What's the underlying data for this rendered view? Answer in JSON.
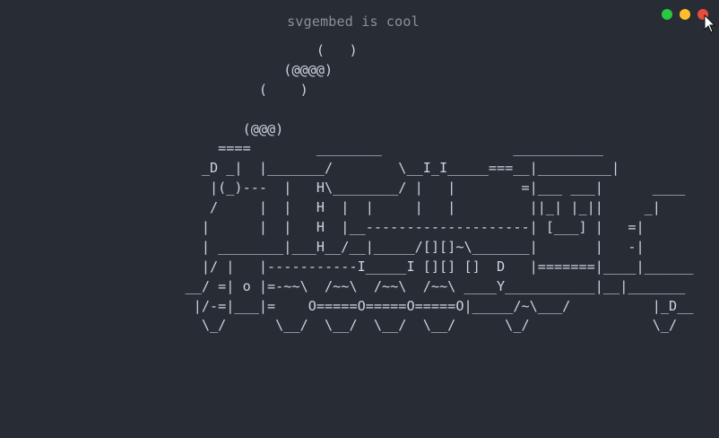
{
  "window": {
    "title": "svgembed is cool",
    "controls": {
      "minimize_color": "#28c840",
      "maximize_color": "#ffbd2e",
      "close_color": "#e74c3c"
    }
  },
  "ascii": {
    "lines": [
      "                    (   )",
      "                (@@@@)",
      "             (    )",
      "",
      "           (@@@)",
      "        ====        ________                ___________",
      "      _D _|  |_______/        \\__I_I_____===__|_________|",
      "       |(_)---  |   H\\________/ |   |        =|___ ___|      ____",
      "       /     |  |   H  |  |     |   |         ||_| |_||     _|",
      "      |      |  |   H  |__--------------------| [___] |   =|",
      "      | ________|___H__/__|_____/[][]~\\_______|       |   -|",
      "      |/ |   |-----------I_____I [][] []  D   |=======|____|______",
      "    __/ =| o |=-~~\\  /~~\\  /~~\\  /~~\\ ____Y___________|__|_______",
      "     |/-=|___|=    O=====O=====O=====O|_____/~\\___/          |_D__",
      "      \\_/      \\__/  \\__/  \\__/  \\__/      \\_/               \\_/"
    ]
  }
}
